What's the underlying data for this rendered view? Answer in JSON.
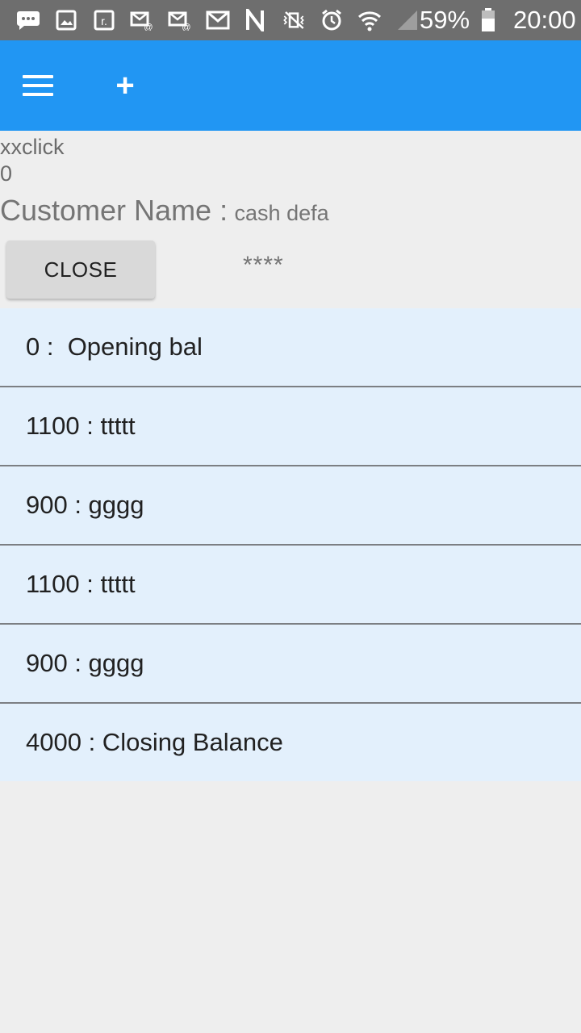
{
  "status_bar": {
    "icons": [
      "chat-icon",
      "image-icon",
      "news-icon",
      "email-icon",
      "email-icon",
      "gmail-icon",
      "nfc-icon",
      "vibrate-mute-icon",
      "alarm-icon",
      "wifi-icon",
      "signal-icon"
    ],
    "battery_percent": "59%",
    "time": "20:00"
  },
  "app_bar": {
    "color": "#2196f3",
    "menu_icon": "hamburger-menu-icon",
    "add_icon": "plus-icon",
    "add_label": "+"
  },
  "header": {
    "click_label": "xxclick",
    "count": "0",
    "customer_label": "Customer Name :",
    "customer_value": "cash defa",
    "close_button": "CLOSE",
    "masked": "****"
  },
  "ledger": [
    {
      "text": "0 :  Opening bal"
    },
    {
      "text": "1100 : ttttt"
    },
    {
      "text": "900 : gggg"
    },
    {
      "text": "1100 : ttttt"
    },
    {
      "text": "900 : gggg"
    },
    {
      "text": "4000 : Closing Balance"
    }
  ]
}
